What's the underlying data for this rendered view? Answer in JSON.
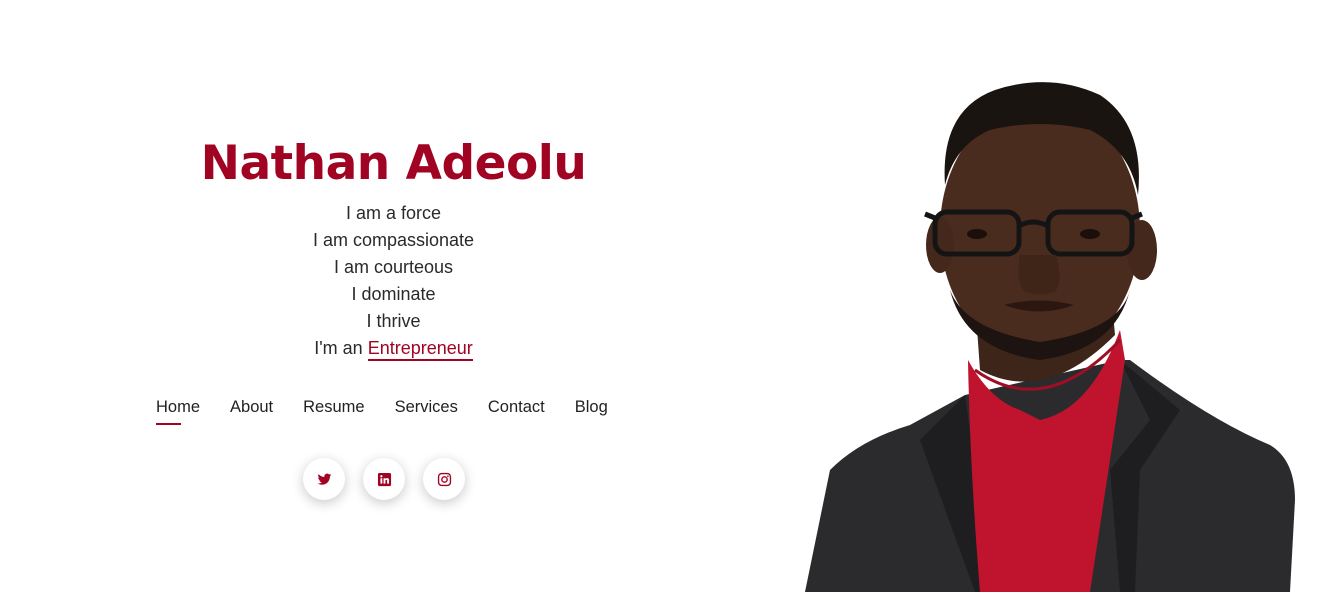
{
  "hero": {
    "name": "Nathan Adeolu",
    "taglines": [
      "I am a force",
      "I am compassionate",
      "I am courteous",
      "I dominate",
      "I thrive"
    ],
    "typed_prefix": "I'm an",
    "typed_word": "Entrepreneur"
  },
  "nav": {
    "items": [
      {
        "label": "Home",
        "active": true
      },
      {
        "label": "About"
      },
      {
        "label": "Resume"
      },
      {
        "label": "Services"
      },
      {
        "label": "Contact"
      },
      {
        "label": "Blog"
      }
    ]
  },
  "social": {
    "icons": [
      "twitter-icon",
      "linkedin-icon",
      "instagram-icon"
    ]
  },
  "theme": {
    "accent": "#a10322",
    "text": "#222222",
    "background": "#ffffff"
  }
}
